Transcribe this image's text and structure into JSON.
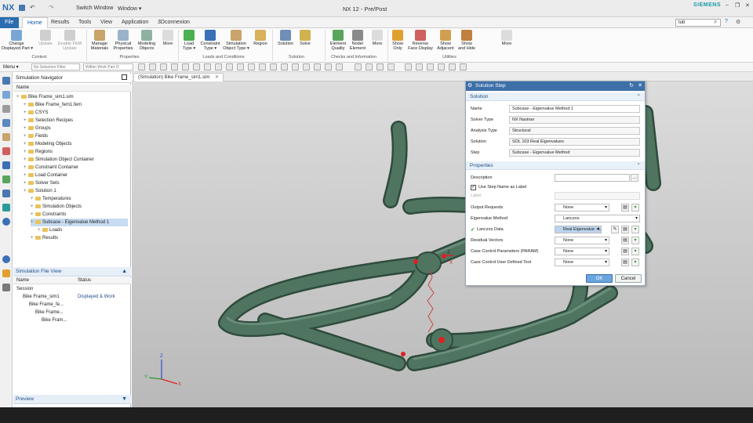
{
  "titlebar": {
    "logo": "NX",
    "qa_switch": "Switch Window",
    "qa_window": "Window ▾",
    "title": "NX 12 - Pre/Post",
    "brand": "SIEMENS",
    "search_value": "tub"
  },
  "tabs": [
    {
      "label": "File"
    },
    {
      "label": "Home"
    },
    {
      "label": "Results"
    },
    {
      "label": "Tools"
    },
    {
      "label": "View"
    },
    {
      "label": "Application"
    },
    {
      "label": "3Dconnexion"
    }
  ],
  "ribbon": {
    "buttons": [
      {
        "label": "Change\nDisplayed Part ▾"
      },
      {
        "label": "Update"
      },
      {
        "label": "Enable FEM\nUpdate"
      },
      {
        "label": "Manage\nMaterials"
      },
      {
        "label": "Physical\nProperties"
      },
      {
        "label": "Modeling\nObjects"
      },
      {
        "label": "More"
      },
      {
        "label": "Load\nType ▾"
      },
      {
        "label": "Constraint\nType ▾"
      },
      {
        "label": "Simulation\nObject Type ▾"
      },
      {
        "label": "Region"
      },
      {
        "label": "Solution"
      },
      {
        "label": "Solve"
      },
      {
        "label": "Element\nQuality"
      },
      {
        "label": "Node/\nElement"
      },
      {
        "label": "More"
      },
      {
        "label": "Show\nOnly"
      },
      {
        "label": "Reverse\nFace Display"
      },
      {
        "label": "Show\nAdjacent"
      },
      {
        "label": "Show\nand Hide"
      },
      {
        "label": "More"
      }
    ],
    "groups": [
      "Context",
      "Properties",
      "Loads and Conditions",
      "Solution",
      "Checks and Information",
      "Utilities"
    ]
  },
  "toolbar": {
    "menu": "Menu ▾",
    "filter": "No Selection Filter",
    "assembly": "Within Work Part O"
  },
  "navigator": {
    "title": "Simulation Navigator",
    "col_name": "Name",
    "items": [
      {
        "label": "Bike Frame_sim1.sim",
        "indent": 0
      },
      {
        "label": "Bike Frame_fem1.fem",
        "indent": 1
      },
      {
        "label": "CSYS",
        "indent": 1
      },
      {
        "label": "Selection Recipes",
        "indent": 1
      },
      {
        "label": "Groups",
        "indent": 1
      },
      {
        "label": "Fields",
        "indent": 1
      },
      {
        "label": "Modeling Objects",
        "indent": 1
      },
      {
        "label": "Regions",
        "indent": 1
      },
      {
        "label": "Simulation Object Container",
        "indent": 1
      },
      {
        "label": "Constraint Container",
        "indent": 1
      },
      {
        "label": "Load Container",
        "indent": 1
      },
      {
        "label": "Solver Sets",
        "indent": 1
      },
      {
        "label": "Solution 1",
        "indent": 1
      },
      {
        "label": "Temperatures",
        "indent": 2
      },
      {
        "label": "Simulation Objects",
        "indent": 2
      },
      {
        "label": "Constraints",
        "indent": 2
      },
      {
        "label": "Subcase - Eigenvalue Method 1",
        "indent": 2,
        "selected": true
      },
      {
        "label": "Loads",
        "indent": 3
      },
      {
        "label": "Results",
        "indent": 2
      }
    ]
  },
  "file_view": {
    "title": "Simulation File View",
    "col_name": "Name",
    "col_status": "Status",
    "rows": [
      {
        "name": "Session",
        "status": "",
        "indent": 0
      },
      {
        "name": "Bike Frame_sim1",
        "status": "Displayed & Work",
        "indent": 1
      },
      {
        "name": "Bike Frame_fe...",
        "status": "",
        "indent": 2
      },
      {
        "name": "Bike Frame...",
        "status": "",
        "indent": 3
      },
      {
        "name": "Bike Fram...",
        "status": "",
        "indent": 4
      }
    ]
  },
  "preview": {
    "title": "Preview"
  },
  "viewport": {
    "tab": "(Simulation) Bike Frame_sim1.sim"
  },
  "dialog": {
    "title": "Solution Step",
    "solution_section": "Solution",
    "fields": [
      {
        "label": "Name",
        "value": "Subcase - Eigenvalue Method 1"
      },
      {
        "label": "Solver Type",
        "value": "NX Nastran"
      },
      {
        "label": "Analysis Type",
        "value": "Structural"
      },
      {
        "label": "Solution",
        "value": "SOL 103 Real Eigenvalues"
      },
      {
        "label": "Step",
        "value": "Subcase - Eigenvalue Method"
      }
    ],
    "properties_section": "Properties",
    "description_label": "Description",
    "use_step_name": "Use Step Name as Label",
    "label_label": "Label",
    "rows": [
      {
        "label": "Output Requests",
        "value": "None"
      },
      {
        "label": "Eigenvalue Method",
        "value": "Lanczos"
      },
      {
        "label": "Lanczos Data",
        "value": "Real Eigenvalue - L"
      },
      {
        "label": "Residual Vectors",
        "value": "None"
      },
      {
        "label": "Case Control Parameters (PARAM)",
        "value": "None"
      },
      {
        "label": "Case Control User Defined Text",
        "value": "None"
      }
    ],
    "ok": "OK",
    "cancel": "Cancel"
  },
  "colors": {
    "accent": "#3d6fa8",
    "frame": "#4f7561",
    "file_tab": "#2a6db0"
  }
}
